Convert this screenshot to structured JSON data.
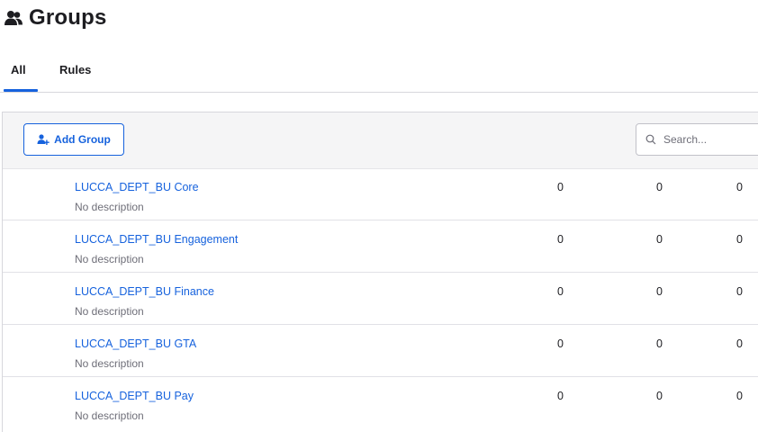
{
  "header": {
    "title": "Groups",
    "icon": "group-icon"
  },
  "tabs": [
    {
      "label": "All",
      "active": true
    },
    {
      "label": "Rules",
      "active": false
    }
  ],
  "toolbar": {
    "add_group_label": "Add Group",
    "add_group_icon": "add-user-icon",
    "search_placeholder": "Search...",
    "search_value": ""
  },
  "colors": {
    "accent": "#1662dd",
    "text": "#1d1d21",
    "muted": "#6e6e78",
    "toolbar_bg": "#f5f5f6"
  },
  "groups": [
    {
      "name": "LUCCA_DEPT_BU Core",
      "description": "No description",
      "counts": [
        "0",
        "0",
        "0"
      ]
    },
    {
      "name": "LUCCA_DEPT_BU Engagement",
      "description": "No description",
      "counts": [
        "0",
        "0",
        "0"
      ]
    },
    {
      "name": "LUCCA_DEPT_BU Finance",
      "description": "No description",
      "counts": [
        "0",
        "0",
        "0"
      ]
    },
    {
      "name": "LUCCA_DEPT_BU GTA",
      "description": "No description",
      "counts": [
        "0",
        "0",
        "0"
      ]
    },
    {
      "name": "LUCCA_DEPT_BU Pay",
      "description": "No description",
      "counts": [
        "0",
        "0",
        "0"
      ]
    }
  ]
}
